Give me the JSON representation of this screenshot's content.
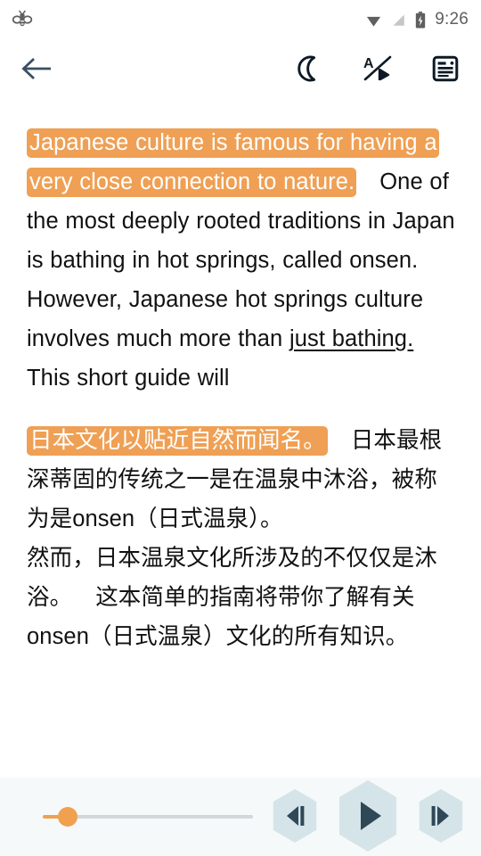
{
  "status_bar": {
    "notification_icon": "bee-icon",
    "wifi_icon": "wifi-icon",
    "no_signal_icon": "no-signal-icon",
    "battery_icon": "battery-charging-icon",
    "time": "9:26"
  },
  "toolbar": {
    "back_icon": "back-arrow-icon",
    "back_label": "Back",
    "night_mode_icon": "moon-icon",
    "night_mode_label": "Night mode",
    "audio_text_sync_icon": "audio-text-sync-icon",
    "audio_text_sync_label": "A/▷",
    "article_view_icon": "article-icon",
    "article_view_label": "Article view",
    "back_icon_color": "#3b4f63",
    "icon_color": "#0d1a26"
  },
  "reader": {
    "highlight_color": "#efa054",
    "highlight_text_color": "#ffffff",
    "text_color": "#111111",
    "english": {
      "highlighted": "Japanese culture is famous for having a very close connection to nature.",
      "rest_1": "One of the most deeply rooted traditions in Japan is bathing in hot springs, called onsen. However, Japanese hot springs culture involves much more than ",
      "underlined": "just bathing.",
      "rest_2": "This short guide will"
    },
    "chinese": {
      "highlighted": "日本文化以贴近自然而闻名。",
      "rest_1": "日本最根深蒂固的传统之一是在温泉中沐浴，被称为是onsen（日式温泉）。",
      "rest_2": "然而，日本温泉文化所涉及的不仅仅是沐浴。",
      "rest_3": "这本简单的指南将带你了解有关onsen（日式温泉）文化的所有知识。"
    }
  },
  "player": {
    "background": "#f5f9fa",
    "slider": {
      "name": "playback-progress-slider",
      "value_percent": 12,
      "fill_color": "#f0a04f",
      "track_color": "#d4d7d9"
    },
    "previous_icon": "skip-previous-icon",
    "previous_label": "Previous",
    "play_icon": "play-icon",
    "play_label": "Play",
    "next_icon": "skip-next-icon",
    "next_label": "Next",
    "button_fill": "#d5e4e8",
    "button_glyph_color": "#2f4858"
  }
}
